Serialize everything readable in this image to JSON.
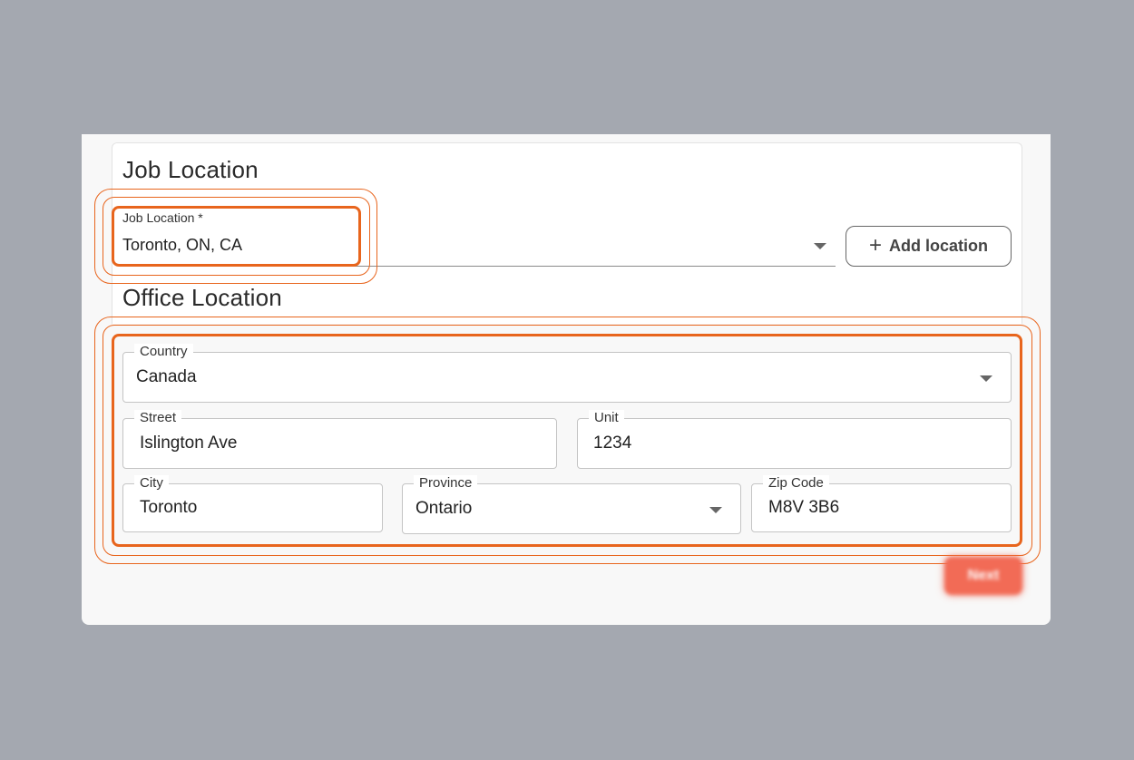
{
  "job_section": {
    "title": "Job Location",
    "field_label": "Job Location",
    "required_mark": "*",
    "value": "Toronto, ON, CA",
    "add_button_label": "Add location",
    "add_button_icon": "plus-icon"
  },
  "office_section": {
    "title": "Office Location",
    "country": {
      "label": "Country",
      "value": "Canada"
    },
    "street": {
      "label": "Street",
      "value": "Islington Ave"
    },
    "unit": {
      "label": "Unit",
      "value": "1234"
    },
    "city": {
      "label": "City",
      "value": "Toronto"
    },
    "province": {
      "label": "Province",
      "value": "Ontario"
    },
    "zip": {
      "label": "Zip Code",
      "value": "M8V 3B6"
    }
  },
  "footer": {
    "next_label": "Next"
  },
  "colors": {
    "highlight": "#e8651d",
    "next_button": "#f26b56",
    "backdrop": "#a4a8b0"
  }
}
